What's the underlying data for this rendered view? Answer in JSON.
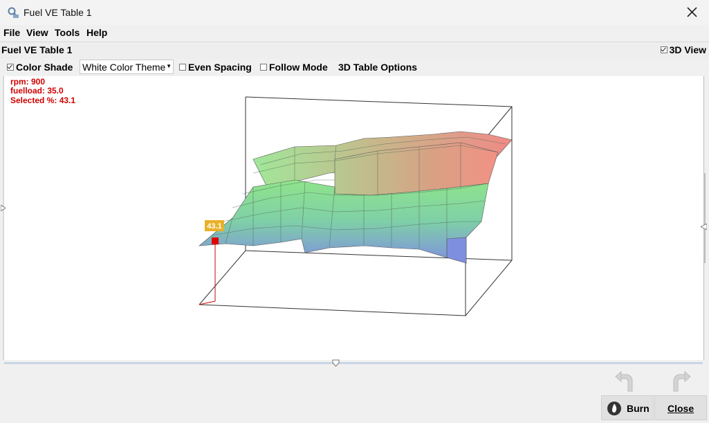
{
  "window": {
    "title": "Fuel VE Table 1"
  },
  "menu": {
    "file": "File",
    "view": "View",
    "tools": "Tools",
    "help": "Help"
  },
  "table_header": {
    "name": "Fuel VE Table 1",
    "view_3d_label": "3D View",
    "view_3d_checked": true
  },
  "options": {
    "color_shade_label": "Color Shade",
    "color_shade_checked": true,
    "color_theme": "White Color Theme",
    "even_spacing_label": "Even Spacing",
    "even_spacing_checked": false,
    "follow_mode_label": "Follow Mode",
    "follow_mode_checked": false,
    "table_options_label": "3D Table Options"
  },
  "readout": {
    "rpm": "rpm: 900",
    "fuelload": "fuelload: 35.0",
    "selected": "Selected %: 43.1"
  },
  "cursor_label": "43.1",
  "buttons": {
    "burn": "Burn",
    "close": "Close"
  }
}
